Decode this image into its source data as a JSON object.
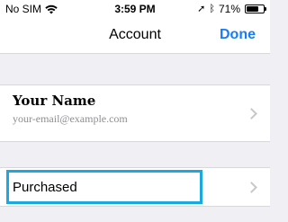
{
  "status_bar": {
    "carrier": "No SIM",
    "time": "3:59 PM",
    "battery_percent": "71%",
    "battery_level": 0.71,
    "icons": [
      "wifi-icon",
      "location-arrow-icon",
      "bluetooth-icon",
      "battery-icon"
    ]
  },
  "nav": {
    "title": "Account",
    "done_label": "Done"
  },
  "profile": {
    "name": "Your Name",
    "email": "your-email@example.com"
  },
  "purchased": {
    "label": "Purchased"
  },
  "colors": {
    "accent": "#1a7cf5",
    "highlight": "#1aa8df",
    "background": "#efeff4",
    "secondary_text": "#8e8e93"
  }
}
